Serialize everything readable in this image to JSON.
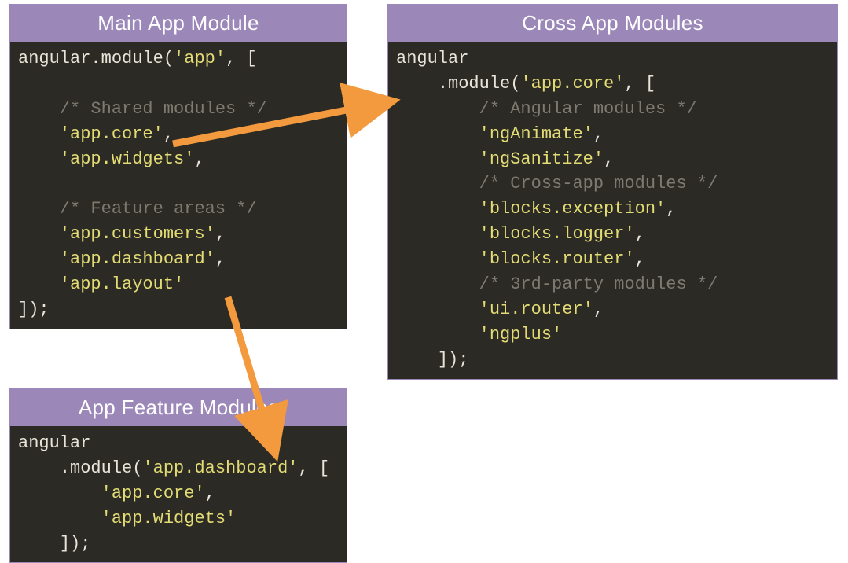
{
  "boxes": {
    "main": {
      "title": "Main App Module",
      "code": {
        "l1a": "angular",
        "l1b": ".module(",
        "l1c": "'app'",
        "l1d": ", [",
        "c1": "/* Shared modules */",
        "s1": "'app.core'",
        "s1p": ",",
        "s2": "'app.widgets'",
        "s2p": ",",
        "c2": "/* Feature areas */",
        "s3": "'app.customers'",
        "s3p": ",",
        "s4": "'app.dashboard'",
        "s4p": ",",
        "s5": "'app.layout'",
        "end": "]);"
      }
    },
    "cross": {
      "title": "Cross App Modules",
      "code": {
        "l1": "angular",
        "l2a": ".module(",
        "l2b": "'app.core'",
        "l2c": ", [",
        "c1": "/* Angular modules */",
        "s1": "'ngAnimate'",
        "s1p": ",",
        "s2": "'ngSanitize'",
        "s2p": ",",
        "c2": "/* Cross-app modules */",
        "s3": "'blocks.exception'",
        "s3p": ",",
        "s4": "'blocks.logger'",
        "s4p": ",",
        "s5": "'blocks.router'",
        "s5p": ",",
        "c3": "/* 3rd-party modules */",
        "s6": "'ui.router'",
        "s6p": ",",
        "s7": "'ngplus'",
        "end": "]);"
      }
    },
    "feature": {
      "title": "App Feature Modules",
      "code": {
        "l1": "angular",
        "l2a": ".module(",
        "l2b": "'app.dashboard'",
        "l2c": ", [",
        "s1": "'app.core'",
        "s1p": ",",
        "s2": "'app.widgets'",
        "end": "]);"
      }
    }
  },
  "diagram": {
    "arrow_color": "#f39a3e",
    "arrows": [
      {
        "from": "main.app.core",
        "to": "cross"
      },
      {
        "from": "main.app.dashboard",
        "to": "feature"
      }
    ]
  }
}
